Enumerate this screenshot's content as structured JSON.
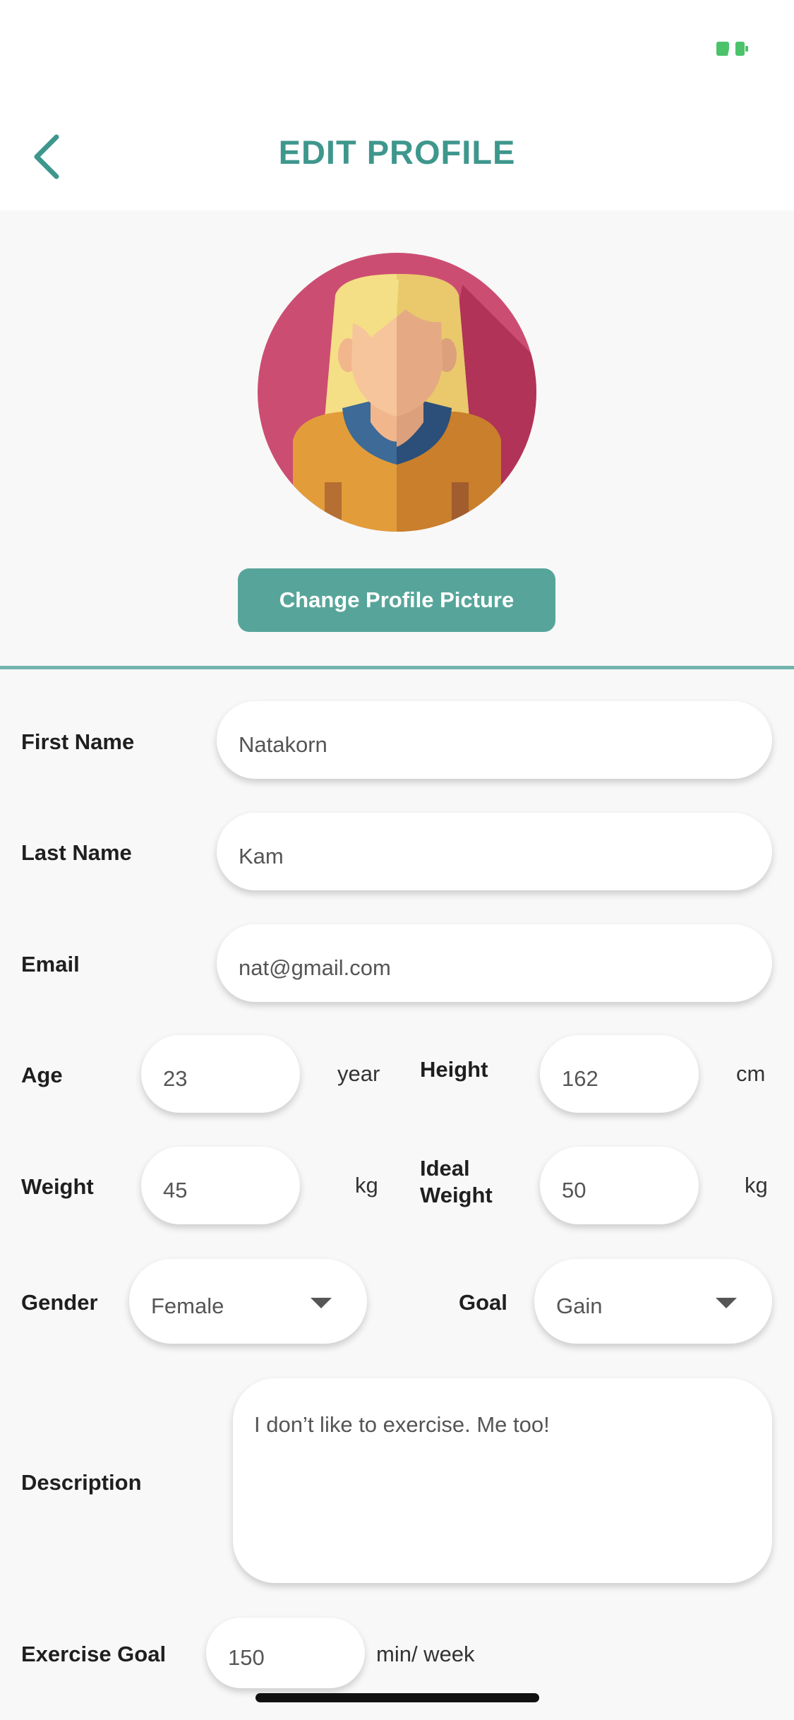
{
  "header": {
    "title": "EDIT PROFILE"
  },
  "profile": {
    "change_picture_label": "Change Profile Picture"
  },
  "form": {
    "first_name": {
      "label": "First Name",
      "value": "Natakorn"
    },
    "last_name": {
      "label": "Last Name",
      "value": "Kam"
    },
    "email": {
      "label": "Email",
      "value": "nat@gmail.com"
    },
    "age": {
      "label": "Age",
      "value": "23",
      "unit": "year"
    },
    "height": {
      "label": "Height",
      "value": "162",
      "unit": "cm"
    },
    "weight": {
      "label": "Weight",
      "value": "45",
      "unit": "kg"
    },
    "ideal_weight": {
      "label_line1": "Ideal",
      "label_line2": "Weight",
      "value": "50",
      "unit": "kg"
    },
    "gender": {
      "label": "Gender",
      "value": "Female"
    },
    "goal": {
      "label": "Goal",
      "value": "Gain"
    },
    "description": {
      "label": "Description",
      "value": "I don’t like to exercise. Me too!"
    },
    "exercise_goal": {
      "label": "Exercise Goal",
      "value": "150",
      "unit": "min/ week"
    }
  },
  "colors": {
    "accent": "#3e978c",
    "button": "#57a59a",
    "divider": "#72b3ad",
    "battery": "#4cc36a"
  },
  "icons": {
    "back": "chevron-left-icon",
    "battery": "battery-icon",
    "dropdown": "caret-down-icon"
  }
}
